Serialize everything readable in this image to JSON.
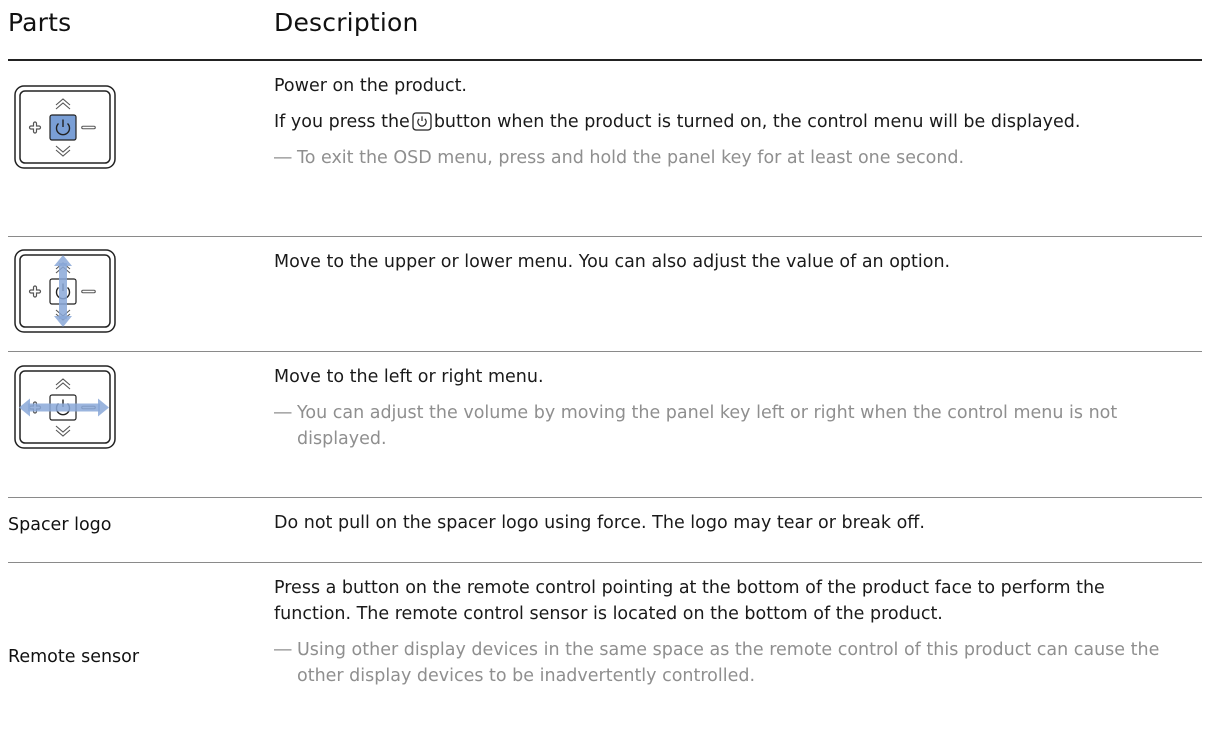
{
  "header": {
    "parts": "Parts",
    "description": "Description"
  },
  "rows": [
    {
      "icon": "panel-key-center-press-icon",
      "lines": [
        "Power on the product.",
        "If you press the",
        "button when the product is turned on, the control menu will be displayed."
      ],
      "note": "To exit the OSD menu, press and hold the panel key for at least one second."
    },
    {
      "icon": "panel-key-up-down-icon",
      "lines": [
        "Move to the upper or lower menu. You can also adjust the value of an option."
      ]
    },
    {
      "icon": "panel-key-left-right-icon",
      "lines": [
        "Move to the left or right menu."
      ],
      "note": "You can adjust the volume by moving the panel key left or right when the control menu is not displayed."
    },
    {
      "label": "Spacer logo",
      "lines": [
        "Do not pull on the spacer logo using force. The logo may tear or break off."
      ]
    },
    {
      "label": "Remote sensor",
      "lines": [
        "Press a button on the remote control pointing at the bottom of the product face to perform the function. The remote control sensor is located on the bottom of the product."
      ],
      "note": "Using other display devices in the same space as the remote control of this product can cause the other display devices to be inadvertently controlled."
    }
  ],
  "note_marker": "―",
  "colors": {
    "accent_fill": "#7a9fd6",
    "arrow_fill": "#8aa8d8",
    "note_text": "#8f8f8f",
    "rule": "#8a8a8a"
  }
}
